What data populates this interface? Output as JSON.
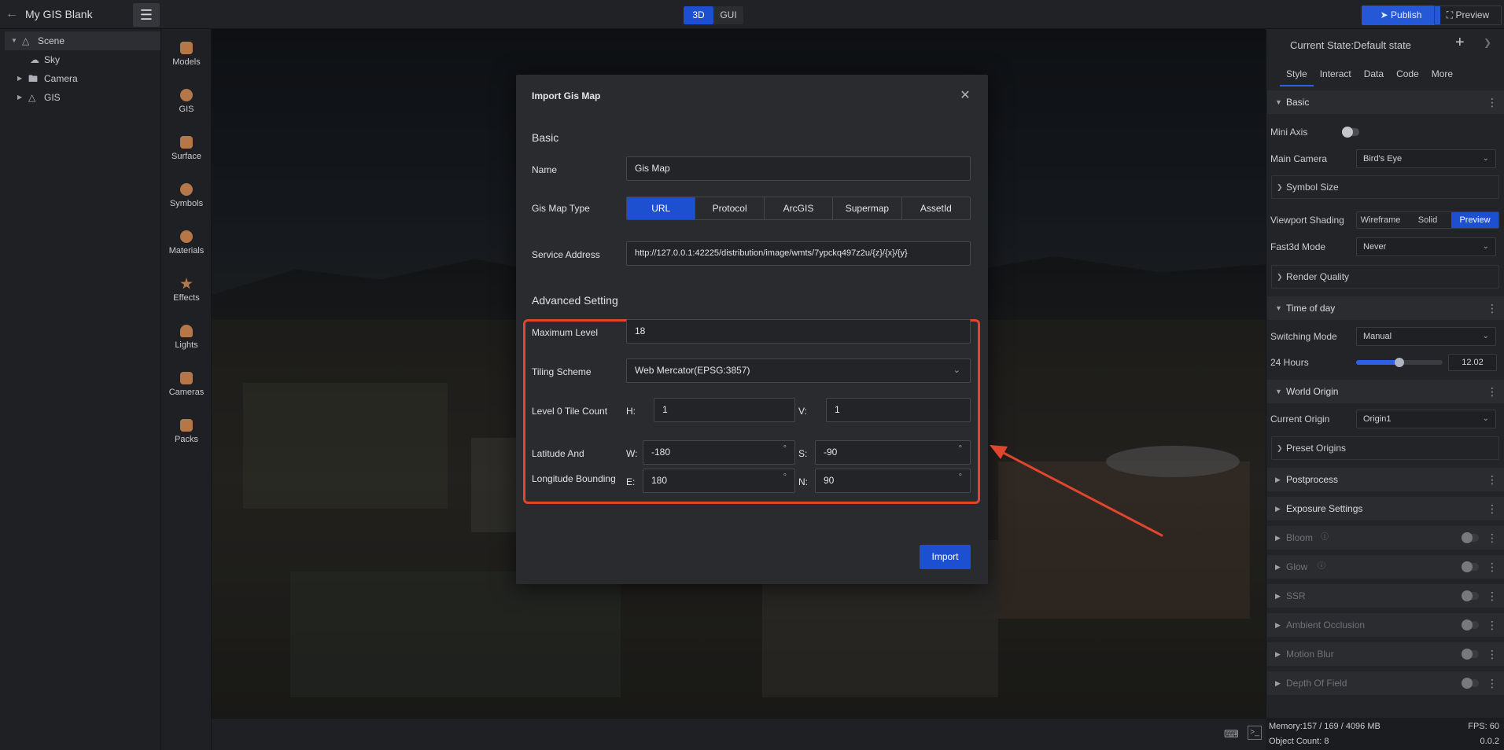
{
  "topbar": {
    "project_name": "My GIS Blank",
    "mode_3d": "3D",
    "mode_gui": "GUI",
    "publish_label": "Publish",
    "preview_label": "Preview"
  },
  "scene_tree": [
    {
      "label": "Scene"
    },
    {
      "label": "Sky"
    },
    {
      "label": "Camera"
    },
    {
      "label": "GIS"
    }
  ],
  "asset_tabs": [
    {
      "label": "Models"
    },
    {
      "label": "GIS"
    },
    {
      "label": "Surface"
    },
    {
      "label": "Symbols"
    },
    {
      "label": "Materials"
    },
    {
      "label": "Effects"
    },
    {
      "label": "Lights"
    },
    {
      "label": "Cameras"
    },
    {
      "label": "Packs"
    }
  ],
  "dialog": {
    "title": "Import Gis Map",
    "basic_heading": "Basic",
    "name_label": "Name",
    "name_value": "Gis Map",
    "type_label": "Gis Map Type",
    "type_options": [
      "URL",
      "Protocol",
      "ArcGIS",
      "Supermap",
      "AssetId"
    ],
    "type_selected": "URL",
    "service_label": "Service Address",
    "service_value": "http://127.0.0.1:42225/distribution/image/wmts/7ypckq497z2u/{z}/{x}/{y}",
    "advanced_heading": "Advanced Setting",
    "max_level_label": "Maximum Level",
    "max_level_value": "18",
    "tiling_label": "Tiling Scheme",
    "tiling_value": "Web Mercator(EPSG:3857)",
    "tile_count_label": "Level 0 Tile Count",
    "h_label": "H:",
    "h_value": "1",
    "v_label": "V:",
    "v_value": "1",
    "bounding_label_1": "Latitude And",
    "bounding_label_2": "Longitude Bounding",
    "w_label": "W:",
    "w_value": "-180",
    "s_label": "S:",
    "s_value": "-90",
    "e_label": "E:",
    "e_value": "180",
    "n_label": "N:",
    "n_value": "90",
    "degree_unit": "°",
    "import_label": "Import"
  },
  "right_panel": {
    "state_title": "Current State:Default state",
    "tabs": [
      "Style",
      "Interact",
      "Data",
      "Code",
      "More"
    ],
    "basic_section": "Basic",
    "mini_axis_label": "Mini Axis",
    "main_camera_label": "Main Camera",
    "main_camera_value": "Bird's Eye",
    "symbol_size_label": "Symbol Size",
    "viewport_shading_label": "Viewport Shading",
    "shading_options": [
      "Wireframe",
      "Solid",
      "Preview"
    ],
    "fast3d_label": "Fast3d Mode",
    "fast3d_value": "Never",
    "render_quality_label": "Render Quality",
    "time_of_day_section": "Time of day",
    "switching_mode_label": "Switching Mode",
    "switching_mode_value": "Manual",
    "hours_label": "24 Hours",
    "hours_value": "12.02",
    "hours_fraction": 0.5,
    "world_origin_section": "World Origin",
    "current_origin_label": "Current Origin",
    "current_origin_value": "Origin1",
    "preset_origins_label": "Preset Origins",
    "postprocess_section": "Postprocess",
    "exposure_section": "Exposure Settings",
    "effects": [
      "Bloom",
      "Glow",
      "SSR",
      "Ambient Occlusion",
      "Motion Blur",
      "Depth Of Field"
    ]
  },
  "status": {
    "memory": "Memory:157 / 169 / 4096 MB",
    "fps": "FPS: 60",
    "object_count": "Object Count: 8",
    "version": "0.0.2"
  },
  "colors": {
    "accent": "#1d4fd1",
    "highlight": "#e0452d"
  }
}
